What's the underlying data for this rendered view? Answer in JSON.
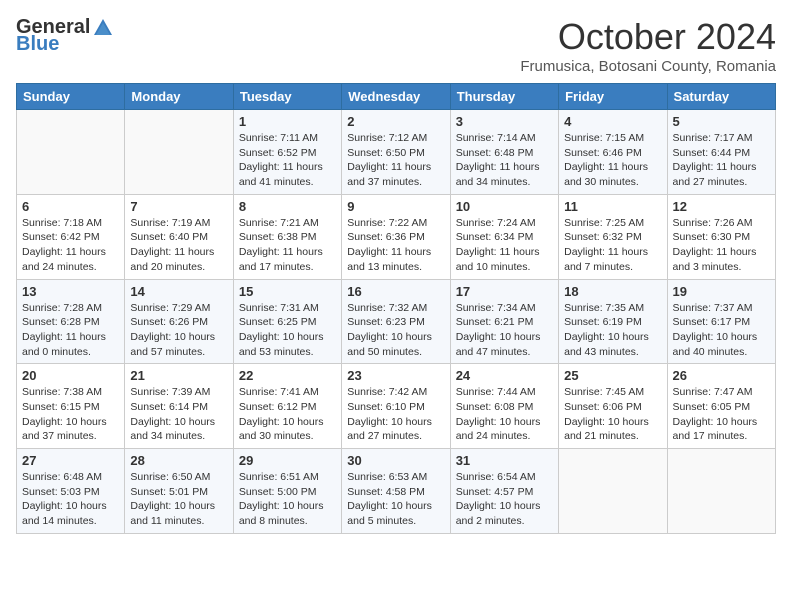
{
  "logo": {
    "general": "General",
    "blue": "Blue"
  },
  "title": "October 2024",
  "location": "Frumusica, Botosani County, Romania",
  "days_of_week": [
    "Sunday",
    "Monday",
    "Tuesday",
    "Wednesday",
    "Thursday",
    "Friday",
    "Saturday"
  ],
  "weeks": [
    [
      {
        "day": "",
        "content": ""
      },
      {
        "day": "",
        "content": ""
      },
      {
        "day": "1",
        "content": "Sunrise: 7:11 AM\nSunset: 6:52 PM\nDaylight: 11 hours and 41 minutes."
      },
      {
        "day": "2",
        "content": "Sunrise: 7:12 AM\nSunset: 6:50 PM\nDaylight: 11 hours and 37 minutes."
      },
      {
        "day": "3",
        "content": "Sunrise: 7:14 AM\nSunset: 6:48 PM\nDaylight: 11 hours and 34 minutes."
      },
      {
        "day": "4",
        "content": "Sunrise: 7:15 AM\nSunset: 6:46 PM\nDaylight: 11 hours and 30 minutes."
      },
      {
        "day": "5",
        "content": "Sunrise: 7:17 AM\nSunset: 6:44 PM\nDaylight: 11 hours and 27 minutes."
      }
    ],
    [
      {
        "day": "6",
        "content": "Sunrise: 7:18 AM\nSunset: 6:42 PM\nDaylight: 11 hours and 24 minutes."
      },
      {
        "day": "7",
        "content": "Sunrise: 7:19 AM\nSunset: 6:40 PM\nDaylight: 11 hours and 20 minutes."
      },
      {
        "day": "8",
        "content": "Sunrise: 7:21 AM\nSunset: 6:38 PM\nDaylight: 11 hours and 17 minutes."
      },
      {
        "day": "9",
        "content": "Sunrise: 7:22 AM\nSunset: 6:36 PM\nDaylight: 11 hours and 13 minutes."
      },
      {
        "day": "10",
        "content": "Sunrise: 7:24 AM\nSunset: 6:34 PM\nDaylight: 11 hours and 10 minutes."
      },
      {
        "day": "11",
        "content": "Sunrise: 7:25 AM\nSunset: 6:32 PM\nDaylight: 11 hours and 7 minutes."
      },
      {
        "day": "12",
        "content": "Sunrise: 7:26 AM\nSunset: 6:30 PM\nDaylight: 11 hours and 3 minutes."
      }
    ],
    [
      {
        "day": "13",
        "content": "Sunrise: 7:28 AM\nSunset: 6:28 PM\nDaylight: 11 hours and 0 minutes."
      },
      {
        "day": "14",
        "content": "Sunrise: 7:29 AM\nSunset: 6:26 PM\nDaylight: 10 hours and 57 minutes."
      },
      {
        "day": "15",
        "content": "Sunrise: 7:31 AM\nSunset: 6:25 PM\nDaylight: 10 hours and 53 minutes."
      },
      {
        "day": "16",
        "content": "Sunrise: 7:32 AM\nSunset: 6:23 PM\nDaylight: 10 hours and 50 minutes."
      },
      {
        "day": "17",
        "content": "Sunrise: 7:34 AM\nSunset: 6:21 PM\nDaylight: 10 hours and 47 minutes."
      },
      {
        "day": "18",
        "content": "Sunrise: 7:35 AM\nSunset: 6:19 PM\nDaylight: 10 hours and 43 minutes."
      },
      {
        "day": "19",
        "content": "Sunrise: 7:37 AM\nSunset: 6:17 PM\nDaylight: 10 hours and 40 minutes."
      }
    ],
    [
      {
        "day": "20",
        "content": "Sunrise: 7:38 AM\nSunset: 6:15 PM\nDaylight: 10 hours and 37 minutes."
      },
      {
        "day": "21",
        "content": "Sunrise: 7:39 AM\nSunset: 6:14 PM\nDaylight: 10 hours and 34 minutes."
      },
      {
        "day": "22",
        "content": "Sunrise: 7:41 AM\nSunset: 6:12 PM\nDaylight: 10 hours and 30 minutes."
      },
      {
        "day": "23",
        "content": "Sunrise: 7:42 AM\nSunset: 6:10 PM\nDaylight: 10 hours and 27 minutes."
      },
      {
        "day": "24",
        "content": "Sunrise: 7:44 AM\nSunset: 6:08 PM\nDaylight: 10 hours and 24 minutes."
      },
      {
        "day": "25",
        "content": "Sunrise: 7:45 AM\nSunset: 6:06 PM\nDaylight: 10 hours and 21 minutes."
      },
      {
        "day": "26",
        "content": "Sunrise: 7:47 AM\nSunset: 6:05 PM\nDaylight: 10 hours and 17 minutes."
      }
    ],
    [
      {
        "day": "27",
        "content": "Sunrise: 6:48 AM\nSunset: 5:03 PM\nDaylight: 10 hours and 14 minutes."
      },
      {
        "day": "28",
        "content": "Sunrise: 6:50 AM\nSunset: 5:01 PM\nDaylight: 10 hours and 11 minutes."
      },
      {
        "day": "29",
        "content": "Sunrise: 6:51 AM\nSunset: 5:00 PM\nDaylight: 10 hours and 8 minutes."
      },
      {
        "day": "30",
        "content": "Sunrise: 6:53 AM\nSunset: 4:58 PM\nDaylight: 10 hours and 5 minutes."
      },
      {
        "day": "31",
        "content": "Sunrise: 6:54 AM\nSunset: 4:57 PM\nDaylight: 10 hours and 2 minutes."
      },
      {
        "day": "",
        "content": ""
      },
      {
        "day": "",
        "content": ""
      }
    ]
  ]
}
